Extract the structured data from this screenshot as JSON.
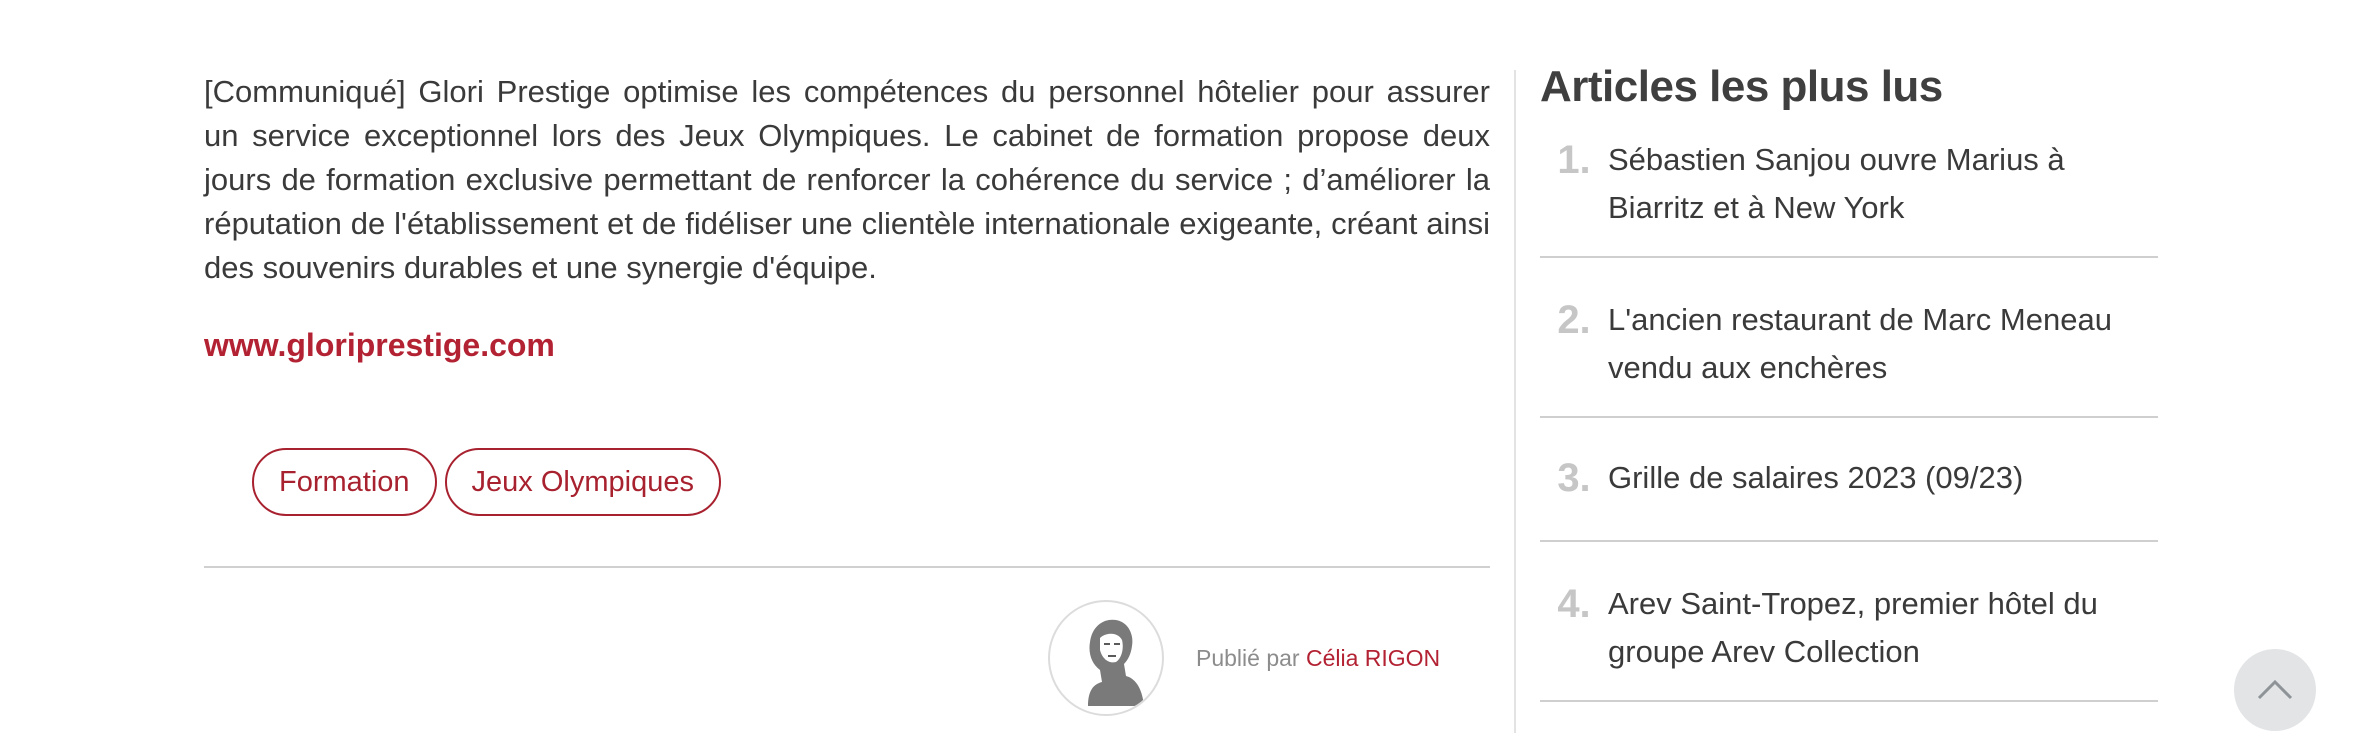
{
  "article": {
    "body": "[Communiqué] Glori Prestige optimise les compétences du personnel hôtelier pour assurer un service exceptionnel lors des Jeux Olympiques. Le cabinet de formation propose deux jours de formation exclusive permettant de renforcer la cohérence du service ; d’améliorer la réputation de l'établissement et de fidéliser une clientèle internationale exigeante, créant ainsi des souvenirs durables et une synergie d'équipe.",
    "website": "www.gloriprestige.com",
    "tags": [
      "Formation",
      "Jeux Olympiques"
    ],
    "author": {
      "published_prefix": "Publié par",
      "name": "Célia RIGON"
    }
  },
  "sidebar": {
    "title": "Articles les plus lus",
    "items": [
      {
        "rank": "1.",
        "title": "Sébastien Sanjou ouvre Marius à Biarritz et à New York"
      },
      {
        "rank": "2.",
        "title": "L'ancien restaurant de Marc Meneau vendu aux enchères"
      },
      {
        "rank": "3.",
        "title": "Grille de salaires 2023 (09/23)"
      },
      {
        "rank": "4.",
        "title": "Arev Saint-Tropez, premier hôtel du groupe Arev Collection"
      }
    ]
  },
  "icons": {
    "scroll_top": "chevron-up-icon",
    "avatar": "author-portrait"
  },
  "colors": {
    "accent": "#b32233",
    "rank_number": "#c6c6c6",
    "scroll_button": "#e2e4e6"
  }
}
